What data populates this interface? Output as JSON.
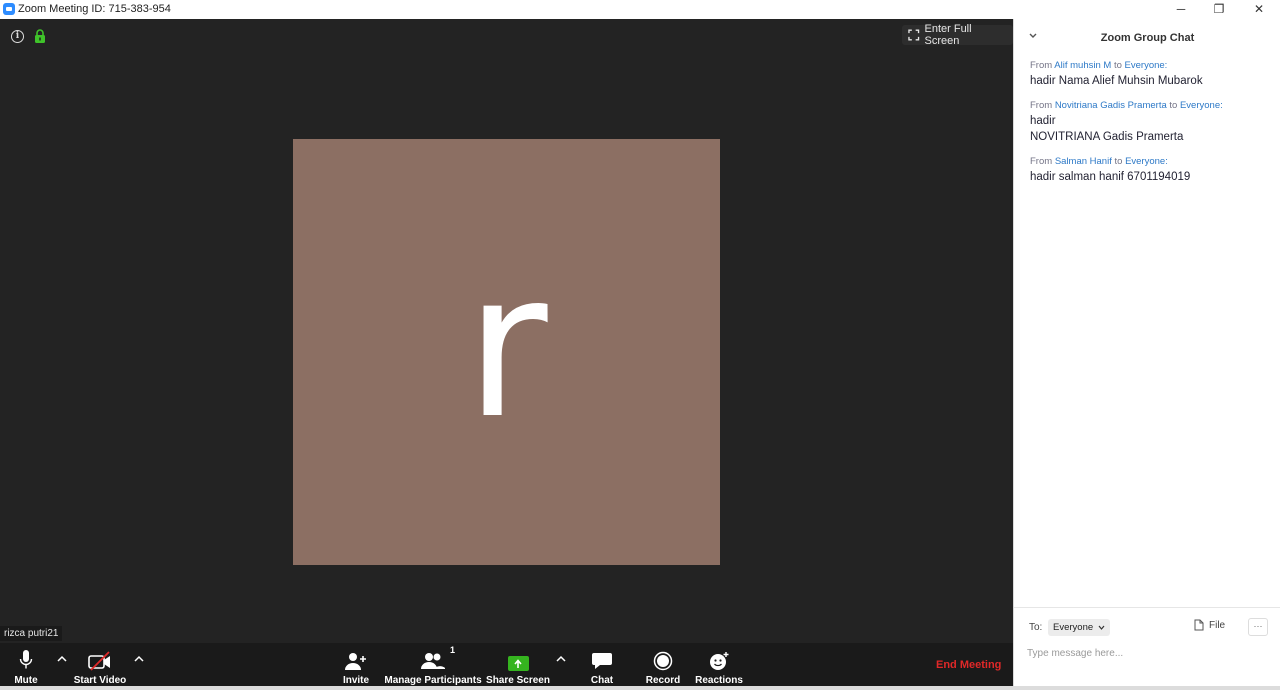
{
  "window": {
    "title": "Zoom Meeting ID: 715-383-954",
    "controls": {
      "minimize": "─",
      "restore": "❐",
      "close": "✕"
    }
  },
  "stage": {
    "full_screen_label": "Enter Full Screen",
    "avatar_letter": "r",
    "avatar_color": "#8c6f63",
    "participant_name": "rizca putri21"
  },
  "toolbar": {
    "mute_label": "Mute",
    "start_video_label": "Start Video",
    "invite_label": "Invite",
    "manage_participants_label": "Manage Participants",
    "participant_count": "1",
    "share_screen_label": "Share Screen",
    "chat_label": "Chat",
    "record_label": "Record",
    "reactions_label": "Reactions",
    "end_meeting_label": "End Meeting"
  },
  "chat": {
    "title": "Zoom Group Chat",
    "messages": [
      {
        "from_word": "From",
        "sender": "Alif muhsin M",
        "to_word": "to",
        "recipient": "Everyone:",
        "body": "hadir Nama Alief Muhsin Mubarok"
      },
      {
        "from_word": "From",
        "sender": "Novitriana Gadis Pramerta",
        "to_word": "to",
        "recipient": "Everyone:",
        "body_line1": "hadir",
        "body_line2": "NOVITRIANA Gadis Pramerta"
      },
      {
        "from_word": "From",
        "sender": "Salman Hanif",
        "to_word": "to",
        "recipient": "Everyone:",
        "body": "hadir salman hanif 6701194019"
      }
    ],
    "to_label": "To:",
    "to_value": "Everyone",
    "file_label": "File",
    "more_label": "···",
    "input_placeholder": "Type message here..."
  },
  "colors": {
    "stage_bg": "#232323",
    "toolbar_bg": "#1a1a1a",
    "end_meeting": "#e02828",
    "share_green": "#35b41f",
    "link_blue": "#2d79c7"
  }
}
